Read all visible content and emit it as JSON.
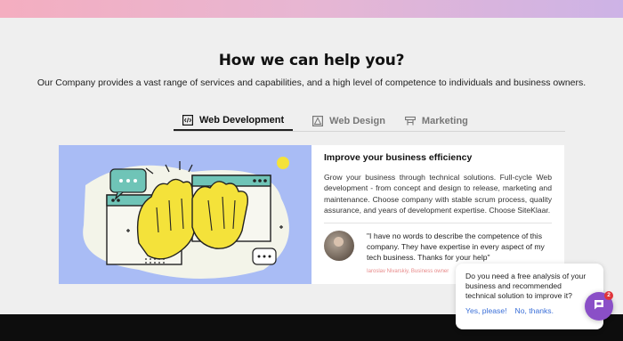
{
  "heading": "How we can help you?",
  "subheading": "Our Company provides a vast range of services and capabilities, and a high level of competence to individuals and business owners.",
  "tabs": [
    {
      "label": "Web Development",
      "icon": "code-icon",
      "active": true
    },
    {
      "label": "Web Design",
      "icon": "design-icon",
      "active": false
    },
    {
      "label": "Marketing",
      "icon": "marketing-icon",
      "active": false
    }
  ],
  "card": {
    "title": "Improve your business efficiency",
    "body": "Grow your business through technical solutions. Full-cycle Web development - from concept and design to release, marketing and maintenance. Choose company with stable scrum process, quality assurance, and years of development expertise. Choose SiteKlaar.",
    "testimonial": {
      "quote": "\"I have no words to describe the competence of this company. They have expertise in every aspect of my tech business. Thanks for your help\"",
      "author": "Iaroslav Nivarskiy, Business owner"
    }
  },
  "chat": {
    "message": "Do you need a free analysis of your business and recommended technical solution to improve it?",
    "yes_label": "Yes, please!",
    "no_label": "No, thanks.",
    "badge_count": "2"
  },
  "colors": {
    "accent_purple": "#8a4fc7",
    "link_blue": "#3a6fd8",
    "badge_red": "#e0343a",
    "illustration_bg": "#a9bcf5"
  }
}
